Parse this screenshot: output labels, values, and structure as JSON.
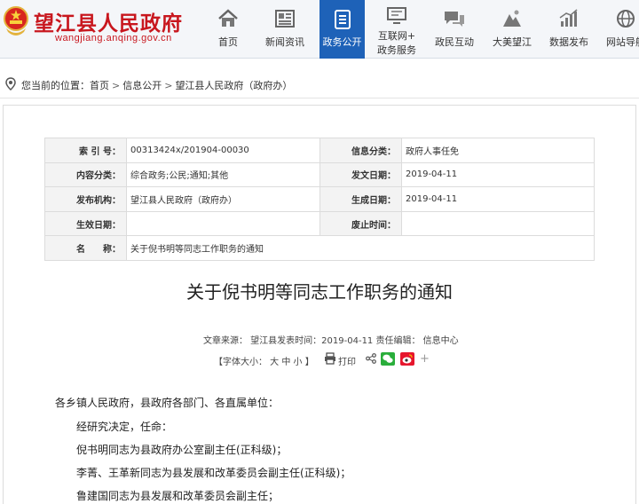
{
  "site": {
    "title": "望江县人民政府",
    "domain": "wangjiang.anqing.gov.cn"
  },
  "nav": [
    {
      "label": "首页",
      "icon": "home-icon"
    },
    {
      "label": "新闻资讯",
      "icon": "newspaper-icon"
    },
    {
      "label": "政务公开",
      "icon": "document-icon",
      "active": true
    },
    {
      "label": "互联网+",
      "label2": "政务服务",
      "icon": "monitor-icon"
    },
    {
      "label": "政民互动",
      "icon": "chat-icon"
    },
    {
      "label": "大美望江",
      "icon": "landscape-icon"
    },
    {
      "label": "数据发布",
      "icon": "bar-chart-icon"
    },
    {
      "label": "网站导航",
      "icon": "globe-icon"
    }
  ],
  "breadcrumb": {
    "prefix": "您当前的位置：",
    "items": [
      "首页",
      "信息公开",
      "望江县人民政府（政府办）"
    ],
    "separator": ">"
  },
  "info": {
    "index_label": "索 引 号：",
    "index_value": "00313424x/201904-00030",
    "category_label": "信息分类：",
    "category_value": "政府人事任免",
    "content_label": "内容分类：",
    "content_value": "综合政务;公民;通知;其他",
    "issue_date_label": "发文日期：",
    "issue_date_value": "2019-04-11",
    "publisher_label": "发布机构：",
    "publisher_value": "望江县人民政府（政府办）",
    "generate_date_label": "生成日期：",
    "generate_date_value": "2019-04-11",
    "effective_label": "生效日期：",
    "effective_value": "",
    "abolish_label": "废止时间：",
    "abolish_value": "",
    "name_label": "名　　称：",
    "name_value": "关于倪书明等同志工作职务的通知"
  },
  "article": {
    "title": "关于倪书明等同志工作职务的通知",
    "meta": "文章来源： 望江县发表时间：2019-04-11 责任编辑： 信息中心",
    "font_size_ctl": "【字体大小： 大  中  小 】",
    "print_label": "打印",
    "paragraphs": [
      "各乡镇人民政府，县政府各部门、各直属单位：",
      "经研究决定，任命：",
      "倪书明同志为县政府办公室副主任(正科级)；",
      "李菁、王革新同志为县发展和改革委员会副主任(正科级)；",
      "鲁建国同志为县发展和改革委员会副主任；"
    ]
  },
  "colors": {
    "brand_red": "#c8171e",
    "nav_active": "#1e62b8"
  }
}
